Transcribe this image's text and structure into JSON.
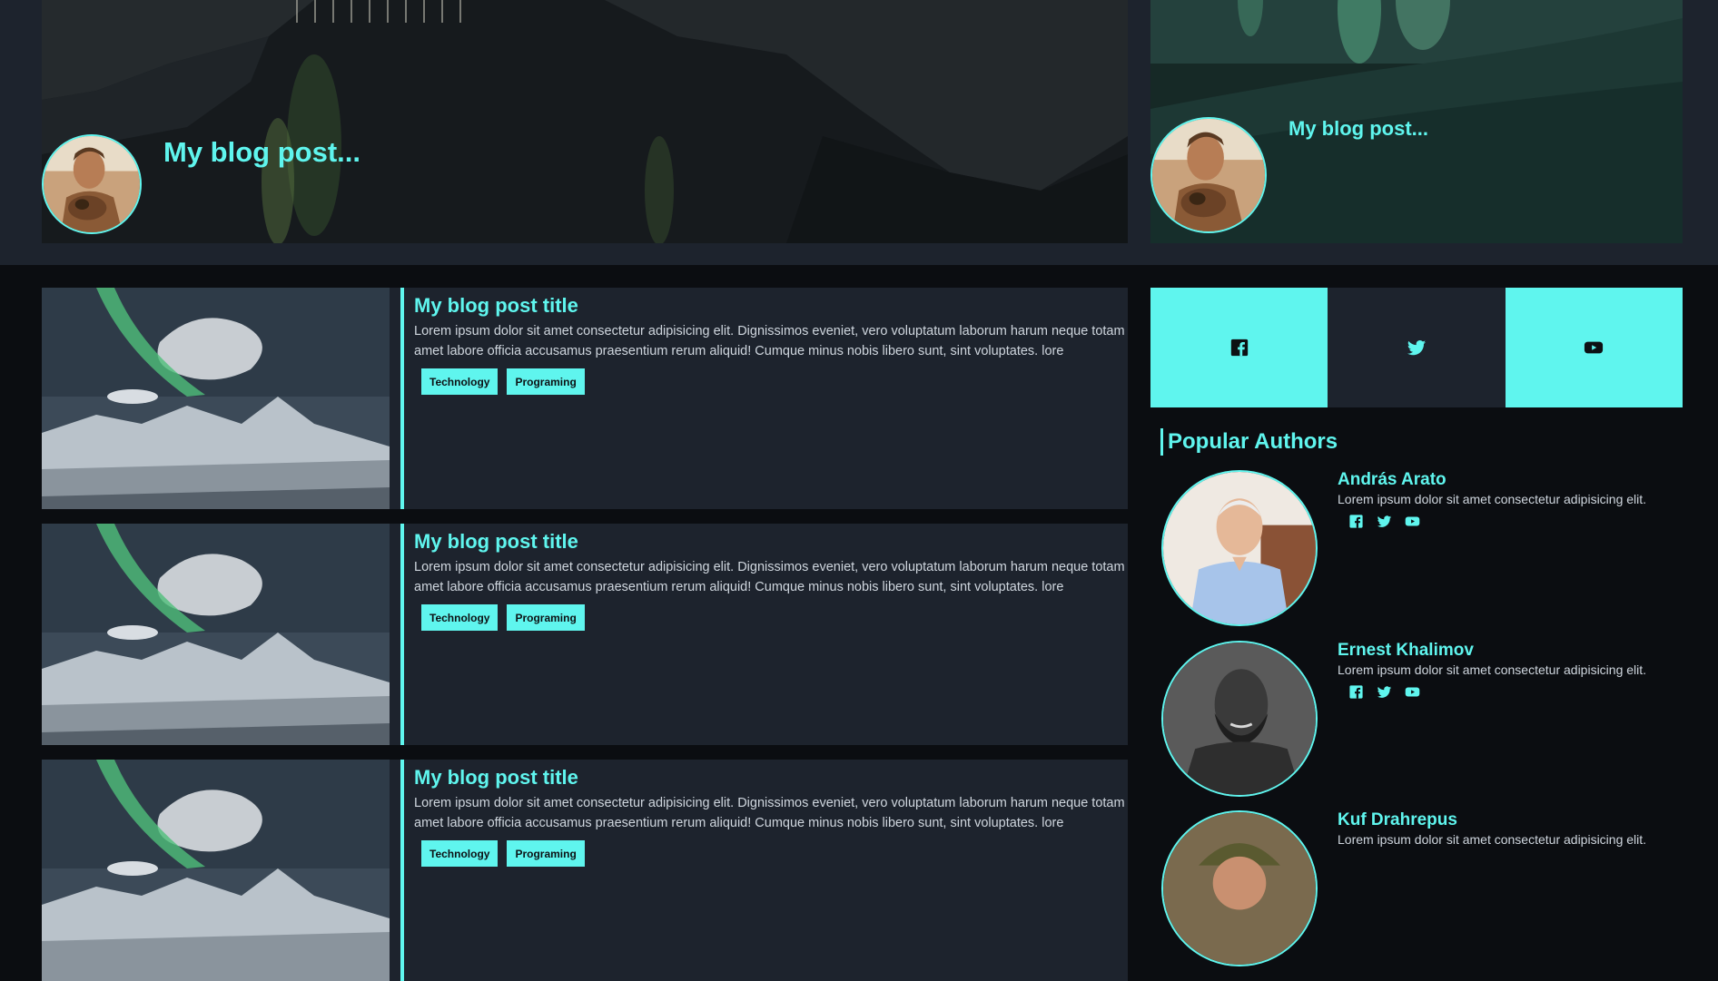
{
  "hero": {
    "main_title": "My blog post...",
    "side_title": "My blog post..."
  },
  "posts": [
    {
      "title": "My blog post title",
      "text": "Lorem ipsum dolor sit amet consectetur adipisicing elit. Dignissimos eveniet, vero voluptatum laborum harum neque totam amet labore officia accusamus praesentium rerum aliquid! Cumque minus nobis libero sunt, sint voluptates. lore",
      "tags": [
        "Technology",
        "Programing"
      ]
    },
    {
      "title": "My blog post title",
      "text": "Lorem ipsum dolor sit amet consectetur adipisicing elit. Dignissimos eveniet, vero voluptatum laborum harum neque totam amet labore officia accusamus praesentium rerum aliquid! Cumque minus nobis libero sunt, sint voluptates. lore",
      "tags": [
        "Technology",
        "Programing"
      ]
    },
    {
      "title": "My blog post title",
      "text": "Lorem ipsum dolor sit amet consectetur adipisicing elit. Dignissimos eveniet, vero voluptatum laborum harum neque totam amet labore officia accusamus praesentium rerum aliquid! Cumque minus nobis libero sunt, sint voluptates. lore",
      "tags": [
        "Technology",
        "Programing"
      ]
    }
  ],
  "social": {
    "icons": [
      "facebook-icon",
      "twitter-icon",
      "youtube-icon"
    ]
  },
  "popular_authors": {
    "title": "Popular Authors",
    "authors": [
      {
        "name": "András Arato",
        "desc": "Lorem ipsum dolor sit amet consectetur adipisicing elit."
      },
      {
        "name": "Ernest Khalimov",
        "desc": "Lorem ipsum dolor sit amet consectetur adipisicing elit."
      },
      {
        "name": "Kuf Drahrepus",
        "desc": "Lorem ipsum dolor sit amet consectetur adipisicing elit."
      }
    ]
  },
  "colors": {
    "accent": "#5ff5ee",
    "panel": "#1d232d",
    "background": "#0b0d11"
  }
}
